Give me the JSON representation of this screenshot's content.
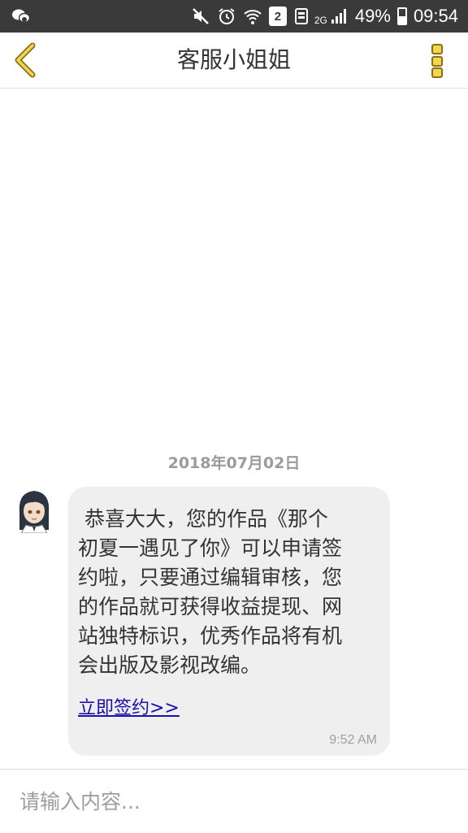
{
  "status_bar": {
    "battery_percent": "49%",
    "battery_level": 0.49,
    "sim_slot": "2",
    "network": "2G",
    "time": "09:54",
    "icons": [
      "wechat-notification-icon",
      "mute-icon",
      "alarm-icon",
      "wifi-icon",
      "sim-icon",
      "volte-icon",
      "signal-icon",
      "battery-icon"
    ]
  },
  "header": {
    "title": "客服小姐姐",
    "accent_color": "#f2d64b"
  },
  "chat": {
    "date": "2018年07月02日",
    "messages": [
      {
        "sender": "agent",
        "text": " 恭喜大大，您的作品《那个\n初夏一遇见了你》可以申请签\n约啦，只要通过编辑审核，您\n的作品就可获得收益提现、网\n站独特标识，优秀作品将有机\n会出版及影视改编。",
        "link": "立即签约>>",
        "time": "9:52 AM"
      }
    ]
  },
  "input": {
    "placeholder": "请输入内容..."
  }
}
